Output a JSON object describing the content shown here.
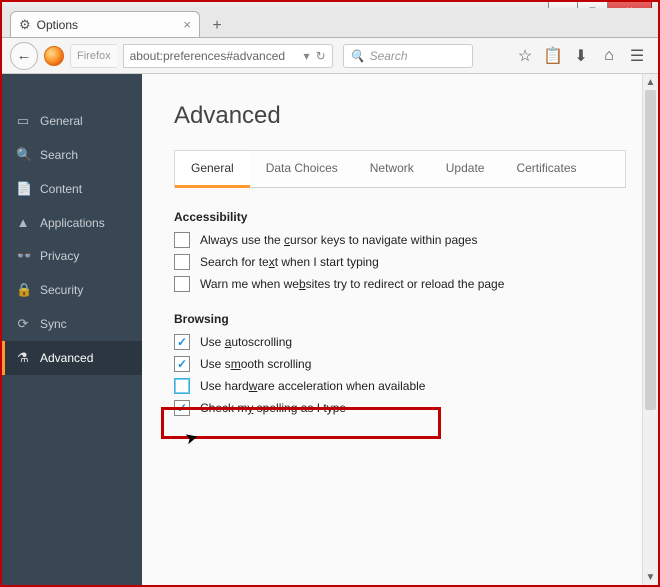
{
  "window": {
    "tab_title": "Options"
  },
  "toolbar": {
    "identity": "Firefox",
    "url": "about:preferences#advanced",
    "search_placeholder": "Search"
  },
  "sidebar": {
    "items": [
      {
        "icon": "▭",
        "label": "General"
      },
      {
        "icon": "🔍",
        "label": "Search"
      },
      {
        "icon": "📄",
        "label": "Content"
      },
      {
        "icon": "▲",
        "label": "Applications"
      },
      {
        "icon": "👓",
        "label": "Privacy"
      },
      {
        "icon": "🔒",
        "label": "Security"
      },
      {
        "icon": "⟳",
        "label": "Sync"
      },
      {
        "icon": "⚗",
        "label": "Advanced"
      }
    ]
  },
  "page": {
    "title": "Advanced",
    "tabs": [
      {
        "label": "General"
      },
      {
        "label": "Data Choices"
      },
      {
        "label": "Network"
      },
      {
        "label": "Update"
      },
      {
        "label": "Certificates"
      }
    ],
    "accessibility": {
      "heading": "Accessibility",
      "items": [
        {
          "pre": "Always use the ",
          "key": "c",
          "post": "ursor keys to navigate within pages",
          "checked": false
        },
        {
          "pre": "Search for te",
          "key": "x",
          "post": "t when I start typing",
          "checked": false
        },
        {
          "pre": "Warn me when we",
          "key": "b",
          "post": "sites try to redirect or reload the page",
          "checked": false
        }
      ]
    },
    "browsing": {
      "heading": "Browsing",
      "items": [
        {
          "pre": "Use ",
          "key": "a",
          "post": "utoscrolling",
          "checked": true
        },
        {
          "pre": "Use s",
          "key": "m",
          "post": "ooth scrolling",
          "checked": true
        },
        {
          "pre": "Use hard",
          "key": "w",
          "post": "are acceleration when available",
          "checked": false,
          "highlight": true
        },
        {
          "pre": "Check m",
          "key": "y",
          "post": " spelling as I type",
          "checked": true
        }
      ]
    }
  }
}
